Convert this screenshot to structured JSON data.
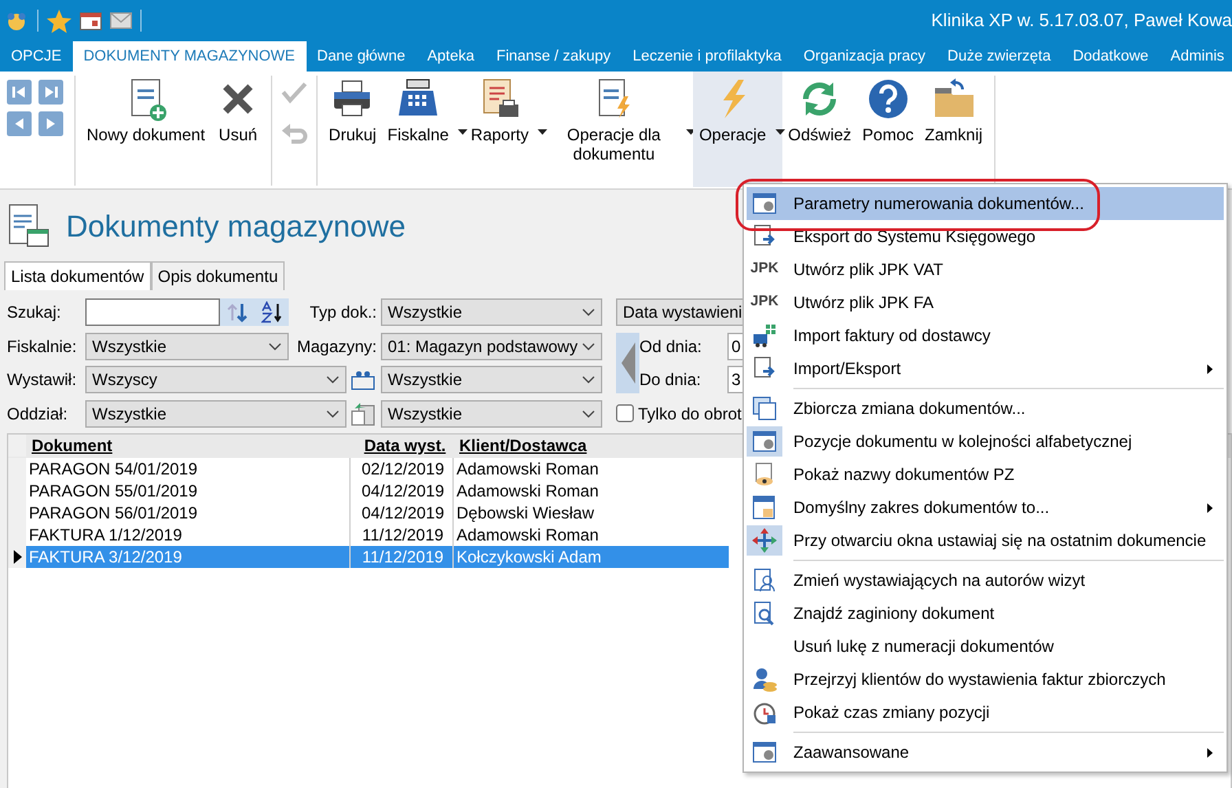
{
  "title_bar": {
    "title": "Klinika XP w. 5.17.03.07, Paweł Kowa"
  },
  "ribbon_tabs": [
    {
      "label": "OPCJE",
      "selected": false
    },
    {
      "label": "DOKUMENTY MAGAZYNOWE",
      "selected": true
    },
    {
      "label": "Dane główne",
      "selected": false
    },
    {
      "label": "Apteka",
      "selected": false
    },
    {
      "label": "Finanse / zakupy",
      "selected": false
    },
    {
      "label": "Leczenie i profilaktyka",
      "selected": false
    },
    {
      "label": "Organizacja pracy",
      "selected": false
    },
    {
      "label": "Duże zwierzęta",
      "selected": false
    },
    {
      "label": "Dodatkowe",
      "selected": false
    },
    {
      "label": "Adminis",
      "selected": false
    }
  ],
  "edit_buttons": [
    {
      "disabled": true
    },
    {
      "disabled": true
    }
  ],
  "ribbon_groups": [
    [
      {
        "label": "Nowy dokument",
        "dropdown": false,
        "pressed": false
      },
      {
        "label": "Usuń",
        "dropdown": false,
        "pressed": false
      }
    ],
    [
      {
        "label": "Drukuj",
        "dropdown": false,
        "pressed": false
      },
      {
        "label": "Fiskalne",
        "dropdown": true,
        "pressed": false
      },
      {
        "label": "Raporty",
        "dropdown": true,
        "pressed": false
      },
      {
        "label": "Operacje dla dokumentu",
        "dropdown": true,
        "pressed": false
      },
      {
        "label": "Operacje",
        "dropdown": true,
        "pressed": true
      },
      {
        "label": "Odśwież",
        "dropdown": false,
        "pressed": false
      },
      {
        "label": "Pomoc",
        "dropdown": false,
        "pressed": false
      },
      {
        "label": "Zamknij",
        "dropdown": false,
        "pressed": false
      }
    ]
  ],
  "page_title": "Dokumenty magazynowe",
  "doc_tabs": [
    {
      "label": "Lista dokumentów",
      "selected": true
    },
    {
      "label": "Opis dokumentu",
      "selected": false
    }
  ],
  "filters": {
    "search_label": "Szukaj:",
    "type_label": "Typ dok.:",
    "type_value": "Wszystkie",
    "date_mode": "Data wystawieni",
    "fiscal_label": "Fiskalnie:",
    "fiscal_value": "Wszystkie",
    "warehouse_label": "Magazyny:",
    "warehouse_value": "01: Magazyn podstawowy",
    "from_label": "Od dnia:",
    "from_value": "0",
    "to_label": "Do dnia:",
    "to_value": "3",
    "issuer_label": "Wystawił:",
    "issuer_value": "Wszyscy",
    "issuer_extra_value": "Wszystkie",
    "branch_label": "Oddział:",
    "branch_value": "Wszystkie",
    "branch_extra_value": "Wszystkie",
    "turnover_label": "Tylko do obrot",
    "turnover_checked": false
  },
  "table": {
    "columns": [
      "Dokument",
      "Data wyst.",
      "Klient/Dostawca"
    ],
    "rows": [
      {
        "cells": [
          "PARAGON 54/01/2019",
          "02/12/2019",
          "Adamowski Roman"
        ],
        "selected": false
      },
      {
        "cells": [
          "PARAGON 55/01/2019",
          "04/12/2019",
          "Adamowski Roman"
        ],
        "selected": false
      },
      {
        "cells": [
          "PARAGON 56/01/2019",
          "04/12/2019",
          "Dębowski Wiesław"
        ],
        "selected": false
      },
      {
        "cells": [
          "FAKTURA 1/12/2019",
          "11/12/2019",
          "Adamowski Roman"
        ],
        "selected": false
      },
      {
        "cells": [
          "FAKTURA 3/12/2019",
          "11/12/2019",
          "Kołczykowski Adam"
        ],
        "selected": true
      }
    ]
  },
  "menu": [
    {
      "kind": "item",
      "label": "Parametry numerowania dokumentów...",
      "selected": true,
      "highlighted": true,
      "checked": false,
      "submenu": false
    },
    {
      "kind": "item",
      "label": "Eksport do Systemu Księgowego",
      "selected": false,
      "highlighted": false,
      "checked": false,
      "submenu": false
    },
    {
      "kind": "item",
      "icon_text": "JPK",
      "label": "Utwórz plik JPK VAT",
      "selected": false,
      "highlighted": false,
      "checked": false,
      "submenu": false
    },
    {
      "kind": "item",
      "icon_text": "JPK",
      "label": "Utwórz plik JPK FA",
      "selected": false,
      "highlighted": false,
      "checked": false,
      "submenu": false
    },
    {
      "kind": "item",
      "label": "Import faktury od dostawcy",
      "selected": false,
      "highlighted": false,
      "checked": false,
      "submenu": false
    },
    {
      "kind": "item",
      "label": "Import/Eksport",
      "selected": false,
      "highlighted": false,
      "checked": false,
      "submenu": true
    },
    {
      "kind": "separator"
    },
    {
      "kind": "item",
      "label": "Zbiorcza zmiana dokumentów...",
      "selected": false,
      "highlighted": false,
      "checked": false,
      "submenu": false
    },
    {
      "kind": "item",
      "label": "Pozycje dokumentu w kolejności alfabetycznej",
      "selected": false,
      "highlighted": false,
      "checked": true,
      "submenu": false
    },
    {
      "kind": "item",
      "label": "Pokaż nazwy dokumentów PZ",
      "selected": false,
      "highlighted": false,
      "checked": false,
      "submenu": false
    },
    {
      "kind": "item",
      "label": "Domyślny zakres dokumentów to...",
      "selected": false,
      "highlighted": false,
      "checked": false,
      "submenu": true
    },
    {
      "kind": "item",
      "label": "Przy otwarciu okna ustawiaj się na ostatnim dokumencie",
      "selected": false,
      "highlighted": false,
      "checked": true,
      "submenu": false
    },
    {
      "kind": "separator"
    },
    {
      "kind": "item",
      "label": "Zmień wystawiających na autorów wizyt",
      "selected": false,
      "highlighted": false,
      "checked": false,
      "submenu": false
    },
    {
      "kind": "item",
      "label": "Znajdź zaginiony dokument",
      "selected": false,
      "highlighted": false,
      "checked": false,
      "submenu": false
    },
    {
      "kind": "item",
      "label": "Usuń lukę z numeracji dokumentów",
      "selected": false,
      "highlighted": false,
      "checked": false,
      "submenu": false
    },
    {
      "kind": "item",
      "label": "Przejrzyj klientów do wystawienia faktur zbiorczych",
      "selected": false,
      "highlighted": false,
      "checked": false,
      "submenu": false
    },
    {
      "kind": "item",
      "label": "Pokaż czas zmiany pozycji",
      "selected": false,
      "highlighted": false,
      "checked": false,
      "submenu": false
    },
    {
      "kind": "separator"
    },
    {
      "kind": "item",
      "label": "Zaawansowane",
      "selected": false,
      "highlighted": false,
      "checked": false,
      "submenu": true
    }
  ]
}
